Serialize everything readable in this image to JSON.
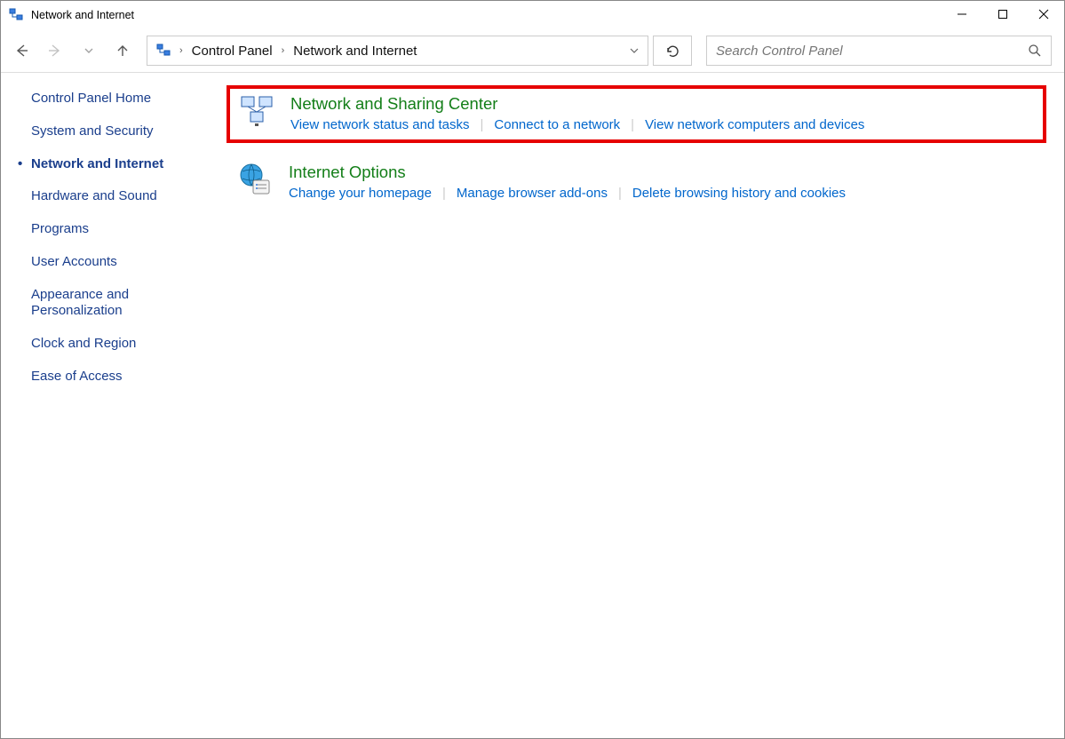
{
  "window": {
    "title": "Network and Internet"
  },
  "breadcrumb": {
    "root": "Control Panel",
    "level1": "Network and Internet"
  },
  "search": {
    "placeholder": "Search Control Panel"
  },
  "sidebar": {
    "items": [
      "Control Panel Home",
      "System and Security",
      "Network and Internet",
      "Hardware and Sound",
      "Programs",
      "User Accounts",
      "Appearance and Personalization",
      "Clock and Region",
      "Ease of Access"
    ],
    "active_index": 2
  },
  "panels": {
    "network_sharing": {
      "title": "Network and Sharing Center",
      "links": [
        "View network status and tasks",
        "Connect to a network",
        "View network computers and devices"
      ]
    },
    "internet_options": {
      "title": "Internet Options",
      "links": [
        "Change your homepage",
        "Manage browser add-ons",
        "Delete browsing history and cookies"
      ]
    }
  }
}
